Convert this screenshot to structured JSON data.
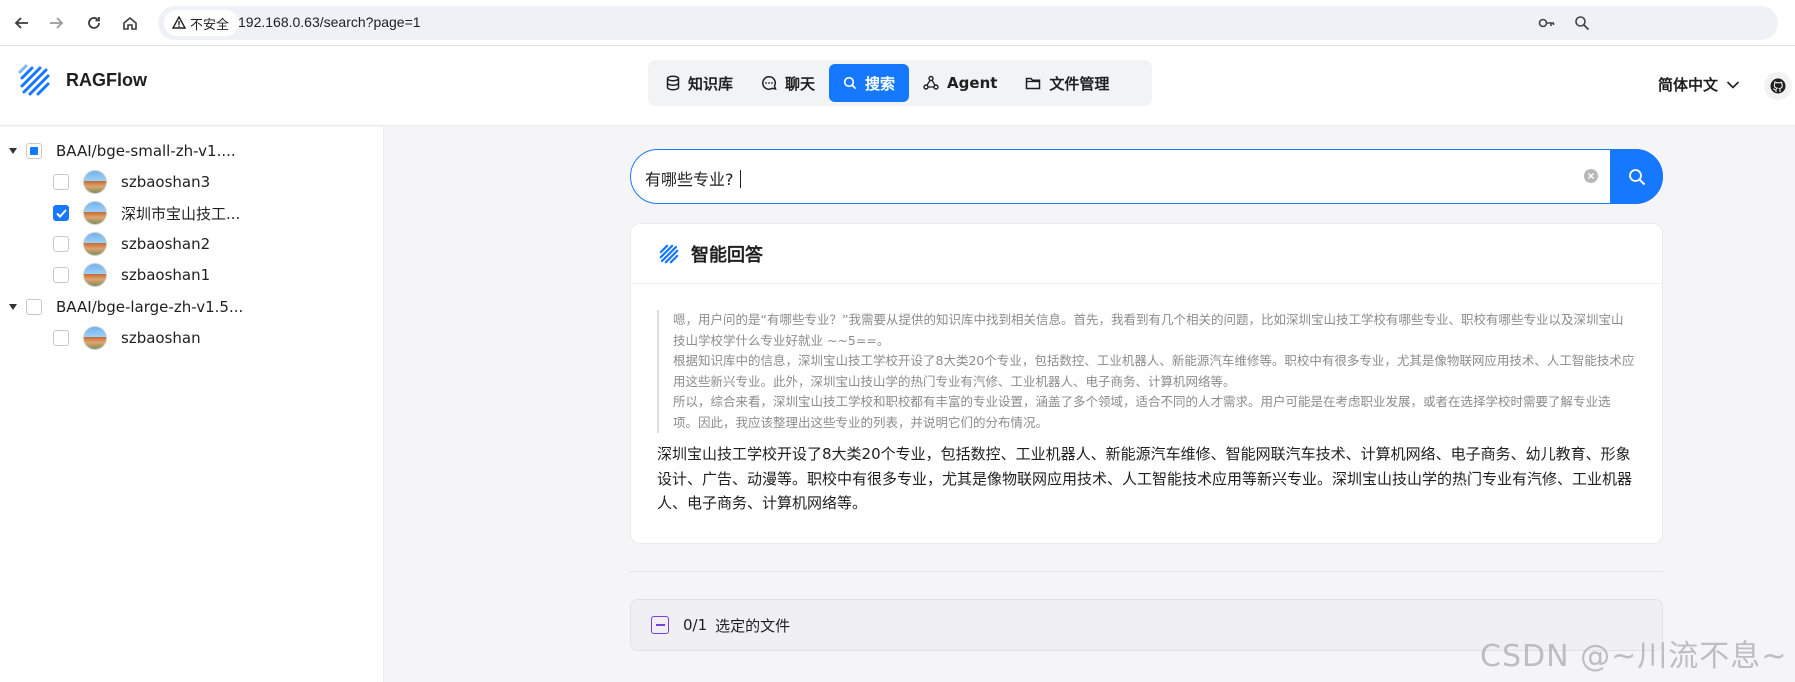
{
  "browser": {
    "security_label": "不安全",
    "url": "192.168.0.63/search?page=1"
  },
  "app": {
    "brand": "RAGFlow",
    "nav": [
      {
        "label": "知识库",
        "icon": "database-icon",
        "active": false
      },
      {
        "label": "聊天",
        "icon": "chat-icon",
        "active": false
      },
      {
        "label": "搜索",
        "icon": "search-icon",
        "active": true
      },
      {
        "label": "Agent",
        "icon": "agent-icon",
        "active": false
      },
      {
        "label": "文件管理",
        "icon": "folder-icon",
        "active": false
      }
    ],
    "language": "简体中文"
  },
  "sidebar": {
    "groups": [
      {
        "label": "BAAI/bge-small-zh-v1....",
        "state": "partial",
        "items": [
          {
            "label": "szbaoshan3",
            "checked": false
          },
          {
            "label": "深圳市宝山技工...",
            "checked": true
          },
          {
            "label": "szbaoshan2",
            "checked": false
          },
          {
            "label": "szbaoshan1",
            "checked": false
          }
        ]
      },
      {
        "label": "BAAI/bge-large-zh-v1.5...",
        "state": "unchecked",
        "items": [
          {
            "label": "szbaoshan",
            "checked": false
          }
        ]
      }
    ]
  },
  "search": {
    "query": "有哪些专业?"
  },
  "answer": {
    "title": "智能回答",
    "thinking": [
      "嗯，用户问的是“有哪些专业？”我需要从提供的知识库中找到相关信息。首先，我看到有几个相关的问题，比如深圳宝山技工学校有哪些专业、职校有哪些专业以及深圳宝山技山学校学什么专业好就业 ~~5==。",
      "根据知识库中的信息，深圳宝山技工学校开设了8大类20个专业，包括数控、工业机器人、新能源汽车维修等。职校中有很多专业，尤其是像物联网应用技术、人工智能技术应用这些新兴专业。此外，深圳宝山技山学的热门专业有汽修、工业机器人、电子商务、计算机网络等。",
      "所以，综合来看，深圳宝山技工学校和职校都有丰富的专业设置，涵盖了多个领域，适合不同的人才需求。用户可能是在考虑职业发展，或者在选择学校时需要了解专业选项。因此，我应该整理出这些专业的列表，并说明它们的分布情况。"
    ],
    "text": "深圳宝山技工学校开设了8大类20个专业，包括数控、工业机器人、新能源汽车维修、智能网联汽车技术、计算机网络、电子商务、幼儿教育、形象设计、广告、动漫等。职校中有很多专业，尤其是像物联网应用技术、人工智能技术应用等新兴专业。深圳宝山技山学的热门专业有汽修、工业机器人、电子商务、计算机网络等。"
  },
  "files": {
    "count": "0/1",
    "label": "选定的文件"
  },
  "watermark": "CSDN @~川流不息~",
  "colors": {
    "accent": "#1677ff",
    "files_icon": "#7b3fe4"
  }
}
